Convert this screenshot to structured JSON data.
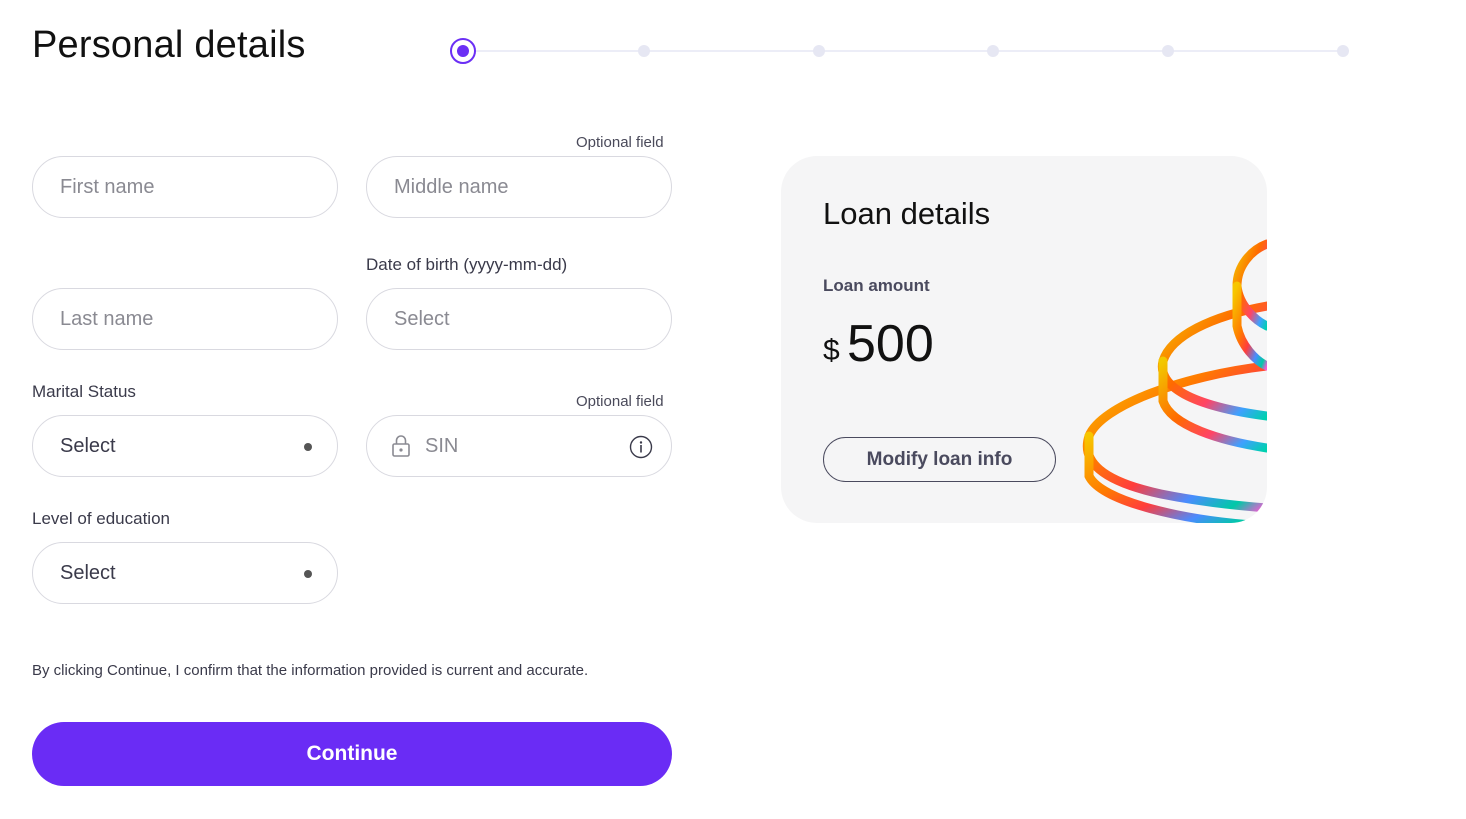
{
  "header": {
    "title": "Personal details"
  },
  "stepper": {
    "total_steps": 6,
    "current_step": 1
  },
  "form": {
    "middle_name_optional": "Optional field",
    "first_name": {
      "placeholder": "First name"
    },
    "middle_name": {
      "placeholder": "Middle name"
    },
    "last_name": {
      "placeholder": "Last name"
    },
    "dob": {
      "label": "Date of birth (yyyy-mm-dd)",
      "placeholder": "Select"
    },
    "marital_status": {
      "label": "Marital Status",
      "value": "Select"
    },
    "sin": {
      "optional": "Optional field",
      "placeholder": "SIN"
    },
    "education": {
      "label": "Level of education",
      "value": "Select"
    },
    "disclaimer": "By clicking Continue, I confirm that the information provided is current and accurate.",
    "continue_label": "Continue"
  },
  "loan": {
    "title": "Loan details",
    "amount_label": "Loan amount",
    "currency": "$",
    "amount": "500",
    "modify_label": "Modify loan info"
  },
  "colors": {
    "accent": "#6a2cf5",
    "card_bg": "#f5f5f6",
    "border": "#d9d9e0"
  },
  "icons": [
    "lock-icon",
    "info-icon",
    "dropdown-dot-icon",
    "coin-stack-illustration"
  ]
}
